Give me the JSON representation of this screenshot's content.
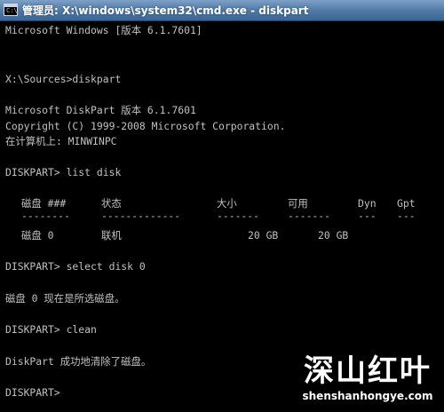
{
  "window": {
    "icon_label": "C:\\",
    "title": "管理员: X:\\windows\\system32\\cmd.exe - diskpart"
  },
  "console": {
    "lines": [
      "Microsoft Windows [版本 6.1.7601]",
      "X:\\Sources>diskpart",
      "Microsoft DiskPart 版本 6.1.7601",
      "Copyright (C) 1999-2008 Microsoft Corporation.",
      "在计算机上: MINWINPC",
      "DISKPART> list disk",
      "DISKPART> select disk 0",
      "磁盘 0 现在是所选磁盘。",
      "DISKPART> clean",
      "DiskPart 成功地清除了磁盘。",
      "DISKPART>"
    ],
    "disk_table": {
      "headers": [
        "磁盘 ###",
        "状态",
        "大小",
        "可用",
        "Dyn",
        "Gpt"
      ],
      "separators": [
        "--------",
        "-------------",
        "-------",
        "-------",
        "---",
        "---"
      ],
      "rows": [
        [
          "磁盘 0",
          "联机",
          "20 GB",
          "20 GB",
          "",
          ""
        ]
      ]
    }
  },
  "watermark": {
    "main": "深山红叶",
    "sub": "shenshanhongye.com"
  },
  "colors": {
    "console_bg": "#000000",
    "console_text": "#c0c0c0",
    "titlebar": "#4e78a6"
  }
}
